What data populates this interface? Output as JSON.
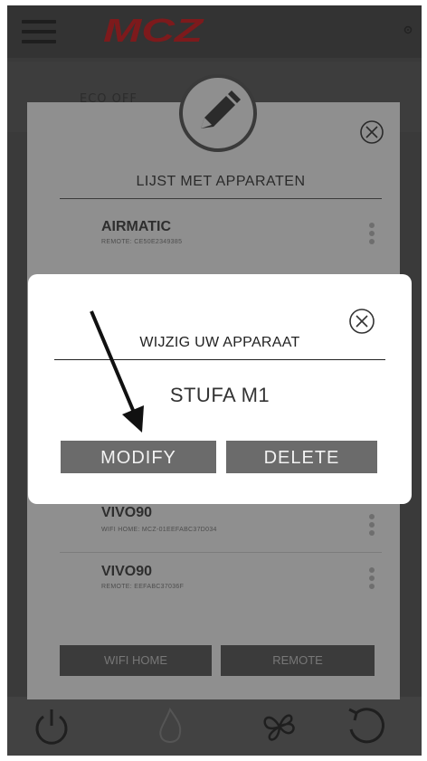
{
  "app": {
    "brand": "MCZ"
  },
  "background": {
    "hidden_label": "ECO OFF"
  },
  "device_list": {
    "title": "LIJST MET APPARATEN",
    "devices": [
      {
        "name": "AIRMATIC",
        "subtitle": "REMOTE: CE50E2349385"
      },
      {
        "name": "VIVO90",
        "subtitle": "WIFI HOME: MCZ-01EEFABC37D034"
      },
      {
        "name": "VIVO90",
        "subtitle": "REMOTE: EEFABC37036F"
      }
    ],
    "buttons": {
      "wifi_home": "WIFI HOME",
      "remote": "REMOTE"
    }
  },
  "modal": {
    "title": "WIJZIG UW APPARAAT",
    "device": "STUFA M1",
    "modify_label": "MODIFY",
    "delete_label": "DELETE"
  },
  "colors": {
    "brand": "#9b1c1f",
    "overlay": "#3a3a3a",
    "button": "#6b6b6b"
  },
  "icons": [
    "menu-icon",
    "gear-icon",
    "pencil-icon",
    "close-icon",
    "power-icon",
    "flame-icon",
    "fan-icon",
    "refresh-icon",
    "arrow-annotation"
  ]
}
